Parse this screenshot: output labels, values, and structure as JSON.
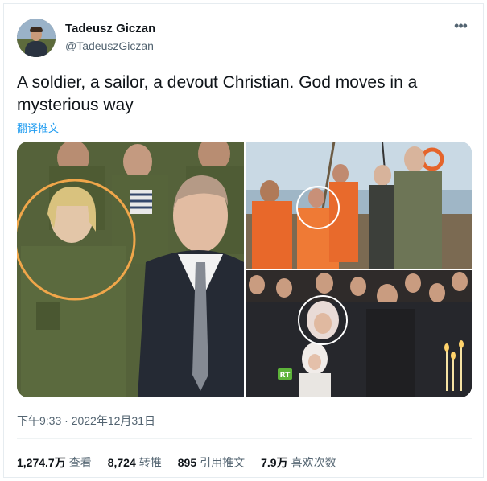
{
  "author": {
    "display_name": "Tadeusz Giczan",
    "handle": "@TadeuszGiczan",
    "avatar_icon": "profile-photo"
  },
  "menu": {
    "more_icon": "ellipsis-icon",
    "more_glyph": "•••"
  },
  "tweet": {
    "text": "A soldier, a sailor, a devout Christian. God moves in a mysterious way",
    "translate_label": "翻译推文"
  },
  "media": {
    "photo1_badge": "",
    "photo3_badge": "RT",
    "highlight_color": "#f0a64a",
    "highlight_color_white": "#ffffff"
  },
  "timestamp": "下午9:33 · 2022年12月31日",
  "stats": [
    {
      "value": "1,274.7万",
      "label": "查看"
    },
    {
      "value": "8,724",
      "label": "转推"
    },
    {
      "value": "895",
      "label": "引用推文"
    },
    {
      "value": "7.9万",
      "label": "喜欢次数"
    }
  ]
}
